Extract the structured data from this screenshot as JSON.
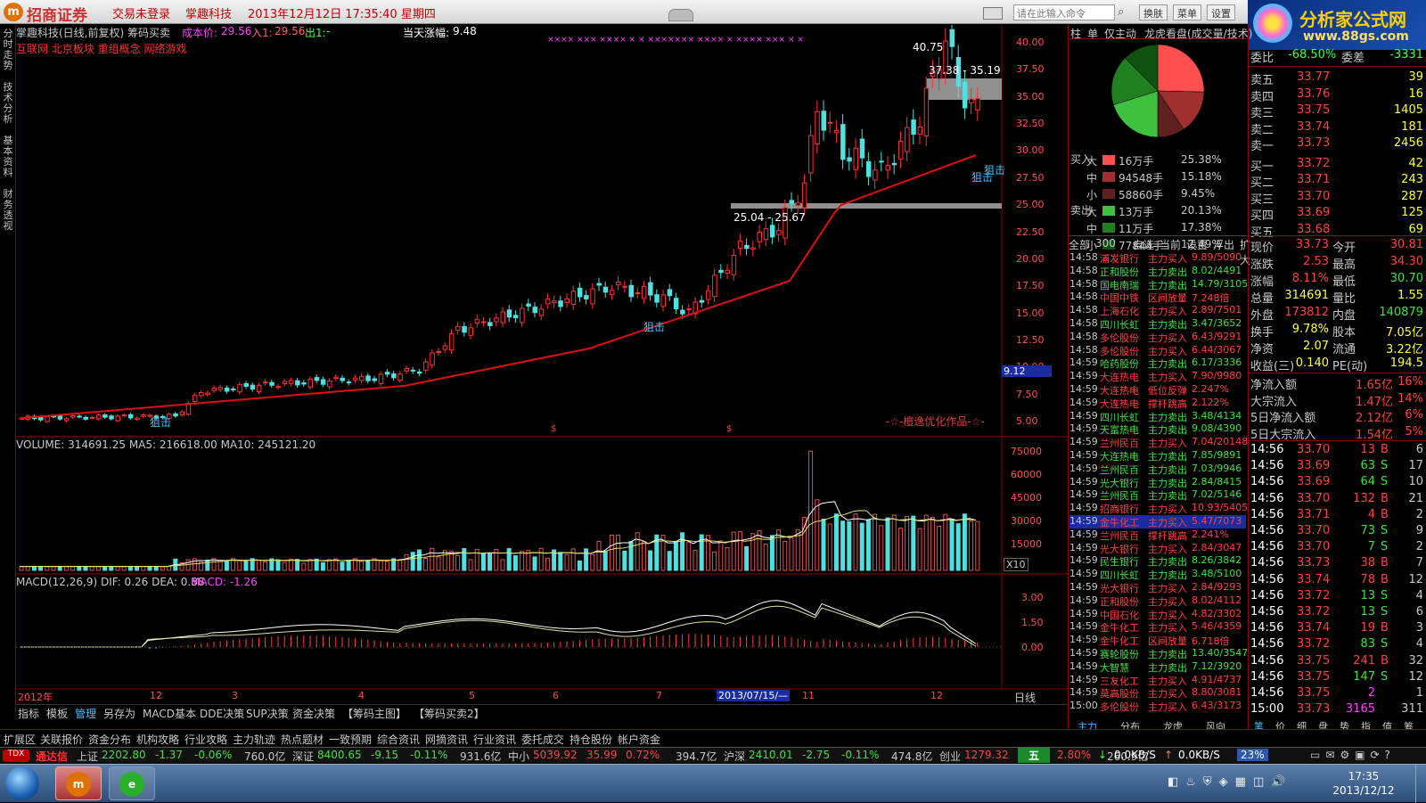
{
  "window": {
    "logo": "招商证券",
    "trade_status": "交易未登录",
    "stock": "掌趣科技",
    "datetime": "2013年12月12日 17:35:40 星期四",
    "cmd_placeholder": "请在此输入命令",
    "btn_skin": "换肤",
    "btn_menu": "菜单",
    "btn_settings": "设置",
    "brand": "分析家公式网",
    "brand_url": "www.88gs.com"
  },
  "left_tabs": [
    "分时走势",
    "技术分析",
    "基本资料",
    "财务透视"
  ],
  "chart": {
    "header": "掌趣科技(日线,前复权) 筹码买卖",
    "cost_label": "成本价:",
    "cost_value": "29.56",
    "in_label": "入1:",
    "in_value": "29.56",
    "out_label": "出1:",
    "out_value": "-",
    "sectors": "互联网 北京板块 重组概念 网络游戏",
    "change_label": "当天涨幅:",
    "change_value": "9.48",
    "label_peak": "40.75",
    "label_range1": "37.38 - 35.19",
    "label_range2": "25.04 - 25.67",
    "label_snipe": "狙击",
    "watermark": "-☆-檀逸优化作品-☆-",
    "xmarks": "×××× ××× ×××× × × ××××××× ×××× × ×××× ××× × ×",
    "price_ticks": [
      "40.00",
      "37.50",
      "35.00",
      "32.50",
      "30.00",
      "27.50",
      "25.00",
      "22.50",
      "20.00",
      "17.50",
      "15.00",
      "12.50",
      "10.00",
      "7.50",
      "5.00"
    ],
    "price_marker": "9.12",
    "dollar": "$",
    "volume_header": "VOLUME: 314691.25  MA5: 216618.00  MA10: 245121.20",
    "vol_ticks": [
      "75000",
      "60000",
      "45000",
      "30000",
      "15000"
    ],
    "vol_unit": "X10",
    "macd_header_prefix": "MACD(12,26,9)  DIF: 0.26  DEA: 0.88",
    "macd_header_macd": "MACD: -1.26",
    "macd_ticks": [
      "3.00",
      "1.50",
      "0.00"
    ],
    "dates": [
      "2012年",
      "12",
      "3",
      "4",
      "5",
      "6",
      "7",
      "2013/07/15/—",
      "11",
      "12"
    ],
    "period": "日线",
    "toolbar": [
      "指标",
      "模板",
      "管理",
      "另存为",
      "MACD基本",
      "DDE决策",
      "SUP决策",
      "资金决策",
      "【筹码主图】",
      "【筹码买卖2】"
    ]
  },
  "mid": {
    "tabs": [
      "柱",
      "单",
      "仅主动",
      "龙虎看盘(成交量/技术)"
    ],
    "flow": [
      {
        "side": "买入",
        "size": "大",
        "amount": "16万手",
        "pct": "25.38%",
        "color": "#ff5050"
      },
      {
        "side": "",
        "size": "中",
        "amount": "94548手",
        "pct": "15.18%",
        "color": "#a03030"
      },
      {
        "side": "",
        "size": "小",
        "amount": "58860手",
        "pct": "9.45%",
        "color": "#602020"
      },
      {
        "side": "卖出",
        "size": "大",
        "amount": "13万手",
        "pct": "20.13%",
        "color": "#40c040"
      },
      {
        "side": "",
        "size": "中",
        "amount": "11万手",
        "pct": "17.38%",
        "color": "#208020"
      },
      {
        "side": "",
        "size": "小",
        "amount": "77844手",
        "pct": "12.49%",
        "color": "#105010"
      }
    ],
    "filters": [
      "全部",
      "300",
      "自选",
      "当前",
      "设置",
      "浮出",
      "扩大"
    ],
    "alerts": [
      [
        "14:58",
        "浦发银行",
        "主力买入",
        "9.89/5090"
      ],
      [
        "14:58",
        "正和股份",
        "主力卖出",
        "8.02/4491"
      ],
      [
        "14:58",
        "国电南瑞",
        "主力卖出",
        "14.79/3105"
      ],
      [
        "14:58",
        "中国中铁",
        "区间放量",
        "7.248倍"
      ],
      [
        "14:58",
        "上海石化",
        "主力买入",
        "2.89/7501"
      ],
      [
        "14:58",
        "四川长虹",
        "主力卖出",
        "3.47/3652"
      ],
      [
        "14:58",
        "多伦股份",
        "主力买入",
        "6.43/9291"
      ],
      [
        "14:58",
        "多伦股份",
        "主力买入",
        "6.44/3067"
      ],
      [
        "14:59",
        "哈药股份",
        "主力卖出",
        "6.17/3336"
      ],
      [
        "14:59",
        "大连热电",
        "主力买入",
        "7.90/9980"
      ],
      [
        "14:59",
        "大连热电",
        "低位反弹",
        "2.247%"
      ],
      [
        "14:59",
        "大连热电",
        "撑杆跳高",
        "2.122%"
      ],
      [
        "14:59",
        "四川长虹",
        "主力卖出",
        "3.48/4134"
      ],
      [
        "14:59",
        "天富热电",
        "主力卖出",
        "9.08/4390"
      ],
      [
        "14:59",
        "兰州民百",
        "主力买入",
        "7.04/20148"
      ],
      [
        "14:59",
        "大连热电",
        "主力卖出",
        "7.85/9891"
      ],
      [
        "14:59",
        "兰州民百",
        "主力卖出",
        "7.03/9946"
      ],
      [
        "14:59",
        "光大银行",
        "主力卖出",
        "2.84/8415"
      ],
      [
        "14:59",
        "兰州民百",
        "主力卖出",
        "7.02/5146"
      ],
      [
        "14:59",
        "招商银行",
        "主力买入",
        "10.93/5405"
      ],
      [
        "14:59",
        "金牛化工",
        "主力买入",
        "5.47/7073"
      ],
      [
        "14:59",
        "兰州民百",
        "撑杆跳高",
        "2.241%"
      ],
      [
        "14:59",
        "光大银行",
        "主力买入",
        "2.84/3047"
      ],
      [
        "14:59",
        "民生银行",
        "主力卖出",
        "8.26/3842"
      ],
      [
        "14:59",
        "四川长虹",
        "主力卖出",
        "3.48/5100"
      ],
      [
        "14:59",
        "光大银行",
        "主力买入",
        "2.84/9293"
      ],
      [
        "14:59",
        "正和股份",
        "主力买入",
        "8.02/4112"
      ],
      [
        "14:59",
        "中国石化",
        "主力买入",
        "4.82/3302"
      ],
      [
        "14:59",
        "金牛化工",
        "主力买入",
        "5.46/4359"
      ],
      [
        "14:59",
        "金牛化工",
        "区间放量",
        "6.718倍"
      ],
      [
        "14:59",
        "赛轮股份",
        "主力卖出",
        "13.40/3547"
      ],
      [
        "14:59",
        "大智慧",
        "主力卖出",
        "7.12/3920"
      ],
      [
        "14:59",
        "三友化工",
        "主力买入",
        "4.91/4737"
      ],
      [
        "14:59",
        "莫高股份",
        "主力买入",
        "8.80/3081"
      ],
      [
        "15:00",
        "多伦股份",
        "主力买入",
        "6.43/3173"
      ]
    ],
    "bottom_tabs": [
      "主力",
      "分布",
      "龙虎",
      "风向"
    ]
  },
  "right": {
    "weibi_label": "委比",
    "weibi": "-68.50%",
    "weicha_label": "委差",
    "weicha": "-3331",
    "asks": [
      [
        "卖五",
        "33.77",
        "39"
      ],
      [
        "卖四",
        "33.76",
        "16"
      ],
      [
        "卖三",
        "33.75",
        "1405"
      ],
      [
        "卖二",
        "33.74",
        "181"
      ],
      [
        "卖一",
        "33.73",
        "2456"
      ]
    ],
    "bids": [
      [
        "买一",
        "33.72",
        "42"
      ],
      [
        "买二",
        "33.71",
        "243"
      ],
      [
        "买三",
        "33.70",
        "287"
      ],
      [
        "买四",
        "33.69",
        "125"
      ],
      [
        "买五",
        "33.68",
        "69"
      ]
    ],
    "stats": [
      [
        "现价",
        "33.73",
        "今开",
        "30.81"
      ],
      [
        "涨跌",
        "2.53",
        "最高",
        "34.30"
      ],
      [
        "涨幅",
        "8.11%",
        "最低",
        "30.70"
      ],
      [
        "总量",
        "314691",
        "量比",
        "1.55"
      ],
      [
        "外盘",
        "173812",
        "内盘",
        "140879"
      ],
      [
        "换手",
        "9.78%",
        "股本",
        "7.05亿"
      ],
      [
        "净资",
        "2.07",
        "流通",
        "3.22亿"
      ],
      [
        "收益(三)",
        "0.140",
        "PE(动)",
        "194.5"
      ]
    ],
    "flows": [
      [
        "净流入额",
        "1.65亿",
        "16%"
      ],
      [
        "大宗流入",
        "1.47亿",
        "14%"
      ],
      [
        "5日净流入额",
        "2.12亿",
        "6%"
      ],
      [
        "5日大宗流入",
        "1.54亿",
        "5%"
      ]
    ],
    "ticks": [
      [
        "14:56",
        "33.70",
        "13",
        "B",
        "6"
      ],
      [
        "14:56",
        "33.69",
        "63",
        "S",
        "17"
      ],
      [
        "14:56",
        "33.69",
        "64",
        "S",
        "10"
      ],
      [
        "14:56",
        "33.70",
        "132",
        "B",
        "21"
      ],
      [
        "14:56",
        "33.71",
        "4",
        "B",
        "2"
      ],
      [
        "14:56",
        "33.70",
        "73",
        "S",
        "9"
      ],
      [
        "14:56",
        "33.70",
        "7",
        "S",
        "2"
      ],
      [
        "14:56",
        "33.73",
        "38",
        "B",
        "7"
      ],
      [
        "14:56",
        "33.74",
        "78",
        "B",
        "12"
      ],
      [
        "14:56",
        "33.72",
        "13",
        "S",
        "4"
      ],
      [
        "14:56",
        "33.72",
        "13",
        "S",
        "6"
      ],
      [
        "14:56",
        "33.74",
        "19",
        "B",
        "3"
      ],
      [
        "14:56",
        "33.72",
        "83",
        "S",
        "4"
      ],
      [
        "14:56",
        "33.75",
        "241",
        "B",
        "32"
      ],
      [
        "14:56",
        "33.75",
        "147",
        "S",
        "12"
      ],
      [
        "14:56",
        "33.75",
        "2",
        "",
        "1"
      ],
      [
        "15:00",
        "33.73",
        "3165",
        "",
        "311"
      ]
    ],
    "bottom_tabs": [
      "笔",
      "价",
      "细",
      "盘",
      "势",
      "指",
      "值",
      "筹"
    ]
  },
  "bottom_tabs": [
    "扩展区",
    "关联报价",
    "资金分布",
    "机构攻略",
    "行业攻略",
    "主力轨迹",
    "热点题材",
    "一致预期",
    "综合资讯",
    "网摘资讯",
    "行业资讯",
    "委托成交",
    "持仓股份",
    "帐户资金"
  ],
  "statusbar": {
    "app": "通达信",
    "sh_label": "上证",
    "sh": "2202.80",
    "sh_chg": "-1.37",
    "sh_pct": "-0.06%",
    "sh_amt": "760.0亿",
    "sz_label": "深证",
    "sz": "8400.65",
    "sz_chg": "-9.15",
    "sz_pct": "-0.11%",
    "sz_amt": "931.6亿",
    "zx_label": "中小",
    "zx": "5039.92",
    "zx_chg": "35.99",
    "zx_pct": "0.72%",
    "zx_amt": "394.7亿",
    "hs_label": "沪深",
    "hs": "2410.01",
    "hs_chg": "-2.75",
    "hs_pct": "-0.11%",
    "hs_amt": "474.8亿",
    "cy_label": "创业",
    "cy": "1279.32",
    "cy_chg": "34.81",
    "cy_pct": "2.80%",
    "cy_amt": "260.9亿",
    "ime": "五",
    "down": "0.0KB/S",
    "up": "0.0KB/S",
    "cpu": "23%"
  },
  "taskbar": {
    "time": "17:35",
    "date": "2013/12/12"
  }
}
